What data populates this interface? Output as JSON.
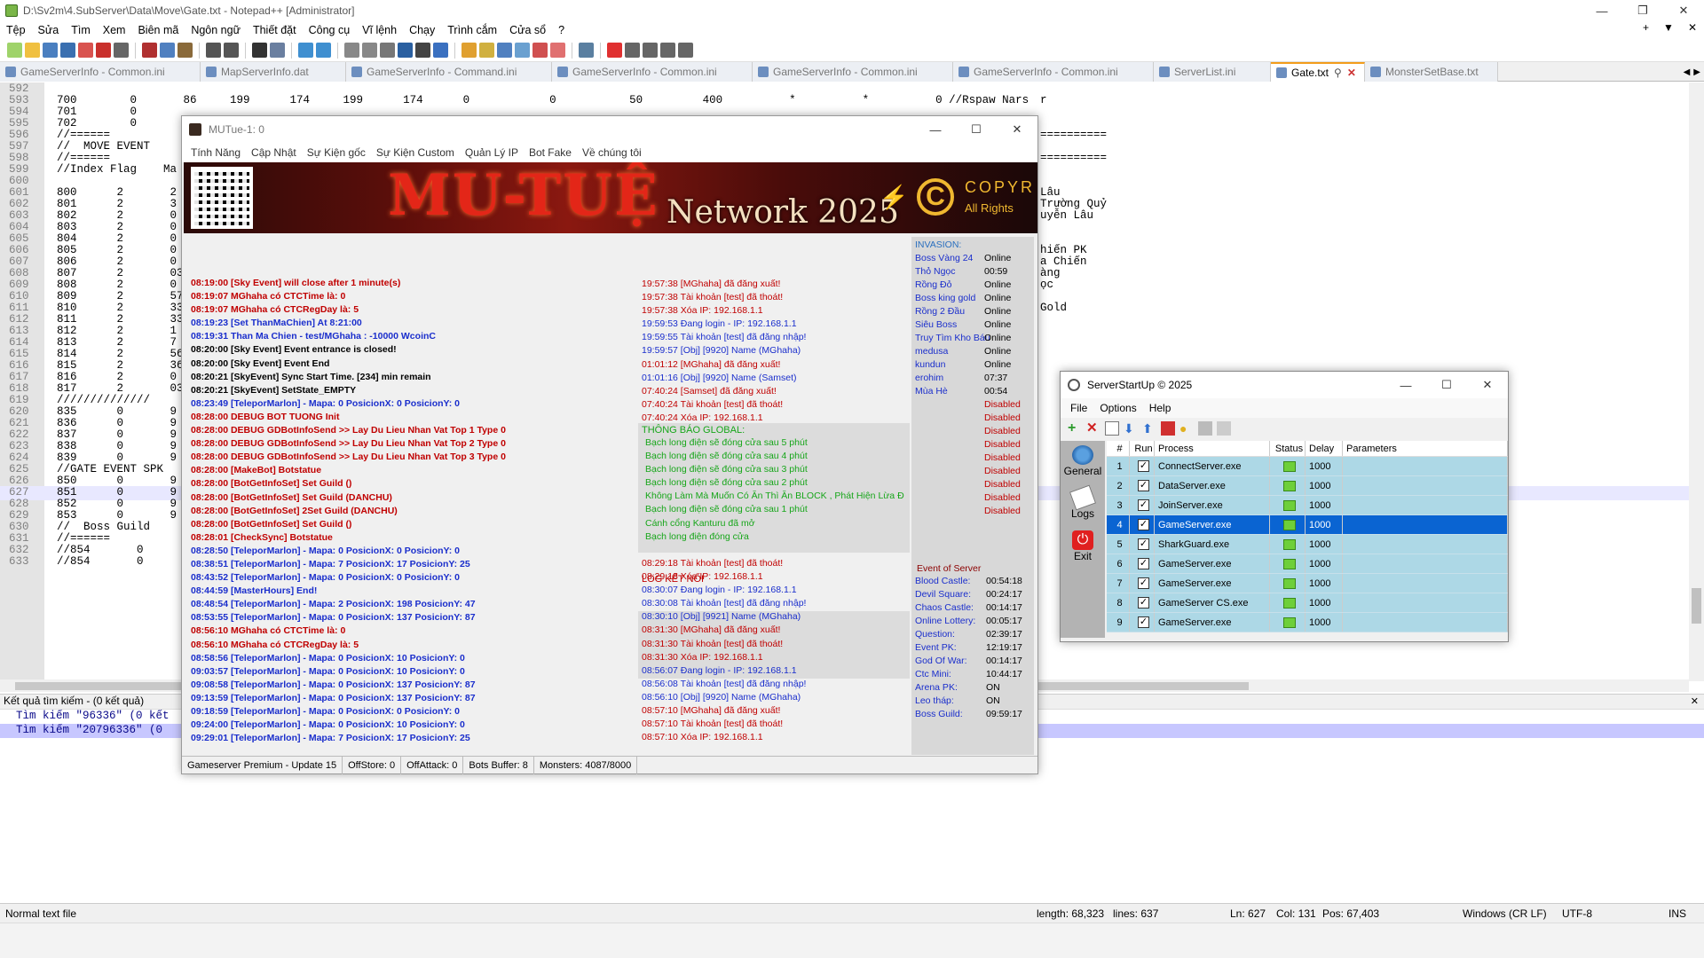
{
  "npp": {
    "title": "D:\\Sv2m\\4.SubServer\\Data\\Move\\Gate.txt - Notepad++ [Administrator]",
    "menu": [
      "Tệp",
      "Sửa",
      "Tìm",
      "Xem",
      "Biên mã",
      "Ngôn ngữ",
      "Thiết đặt",
      "Công cụ",
      "Vĩ lệnh",
      "Chạy",
      "Trình cắm",
      "Cửa sổ",
      "?"
    ],
    "menu_right": [
      "+",
      "▼",
      "✕"
    ],
    "tabs": [
      {
        "label": "GameServerInfo - Common.ini",
        "active": false
      },
      {
        "label": "MapServerInfo.dat",
        "active": false
      },
      {
        "label": "GameServerInfo - Command.ini",
        "active": false
      },
      {
        "label": "GameServerInfo - Common.ini",
        "active": false
      },
      {
        "label": "GameServerInfo - Common.ini",
        "active": false
      },
      {
        "label": "GameServerInfo - Common.ini",
        "active": false
      },
      {
        "label": "ServerList.ini",
        "active": false
      },
      {
        "label": "Gate.txt",
        "active": true
      },
      {
        "label": "MonsterSetBase.txt",
        "active": false
      }
    ],
    "lines": [
      {
        "n": "592",
        "t": ""
      },
      {
        "n": "593",
        "t": "700        0       86     199      174     199      174      0            0           50         400          *          *          0 //Rspaw Nars"
      },
      {
        "n": "594",
        "t": "701        0"
      },
      {
        "n": "595",
        "t": "702        0"
      },
      {
        "n": "596",
        "t": "//======"
      },
      {
        "n": "597",
        "t": "//  MOVE EVENT"
      },
      {
        "n": "598",
        "t": "//======"
      },
      {
        "n": "599",
        "t": "//Index Flag    Ma"
      },
      {
        "n": "600",
        "t": ""
      },
      {
        "n": "601",
        "t": "800      2       2"
      },
      {
        "n": "602",
        "t": "801      2       3"
      },
      {
        "n": "603",
        "t": "802      2       0"
      },
      {
        "n": "604",
        "t": "803      2       0"
      },
      {
        "n": "605",
        "t": "804      2       0"
      },
      {
        "n": "606",
        "t": "805      2       0"
      },
      {
        "n": "607",
        "t": "806      2       0"
      },
      {
        "n": "608",
        "t": "807      2       03"
      },
      {
        "n": "609",
        "t": "808      2       0"
      },
      {
        "n": "610",
        "t": "809      2       57"
      },
      {
        "n": "611",
        "t": "810      2       33"
      },
      {
        "n": "612",
        "t": "811      2       33"
      },
      {
        "n": "613",
        "t": "812      2       1"
      },
      {
        "n": "614",
        "t": "813      2       7"
      },
      {
        "n": "615",
        "t": "814      2       56"
      },
      {
        "n": "616",
        "t": "815      2       36"
      },
      {
        "n": "617",
        "t": "816      2       0"
      },
      {
        "n": "618",
        "t": "817      2       03"
      },
      {
        "n": "619",
        "t": "//////////////"
      },
      {
        "n": "620",
        "t": "835      0       9"
      },
      {
        "n": "621",
        "t": "836      0       9"
      },
      {
        "n": "622",
        "t": "837      0       9"
      },
      {
        "n": "623",
        "t": "838      0       9"
      },
      {
        "n": "624",
        "t": "839      0       9"
      },
      {
        "n": "625",
        "t": "//GATE EVENT SPK"
      },
      {
        "n": "626",
        "t": "850      0       9"
      },
      {
        "n": "627",
        "t": "851      0       9"
      },
      {
        "n": "628",
        "t": "852      0       9"
      },
      {
        "n": "629",
        "t": "853      0       9"
      },
      {
        "n": "630",
        "t": "//  Boss Guild"
      },
      {
        "n": "631",
        "t": "//======"
      },
      {
        "n": "632",
        "t": "//854       0"
      },
      {
        "n": "633",
        "t": "//854       0"
      }
    ],
    "right_fragments": [
      {
        "text": "r",
        "row": 1
      },
      {
        "text": "==========",
        "row": 4
      },
      {
        "text": "==========",
        "row": 6
      },
      {
        "text": "Lâu",
        "row": 9
      },
      {
        "text": "Trường Quỷ",
        "row": 10
      },
      {
        "text": "uyễn Lâu",
        "row": 11
      },
      {
        "text": "hiến PK",
        "row": 14
      },
      {
        "text": "a Chiến",
        "row": 15
      },
      {
        "text": "àng",
        "row": 16
      },
      {
        "text": "ọc",
        "row": 17
      },
      {
        "text": "Gold",
        "row": 19
      }
    ],
    "search_panel": {
      "title": "Kết quả tìm kiếm - (0 kết quả)",
      "rows": [
        "Tìm kiếm \"96336\" (0 kết",
        "Tìm kiếm \"20796336\" (0"
      ]
    },
    "status": {
      "type": "Normal text file",
      "length": "length: 68,323",
      "lines": "lines: 637",
      "ln": "Ln: 627",
      "col": "Col: 131",
      "pos": "Pos: 67,403",
      "eol": "Windows (CR LF)",
      "enc": "UTF-8",
      "ins": "INS"
    }
  },
  "mutue": {
    "title": "MUTue-1: 0",
    "menu": [
      "Tính Năng",
      "Cập Nhật",
      "Sự Kiện gốc",
      "Sự Kiện Custom",
      "Quản Lý IP",
      "Bot Fake",
      "Về chúng tôi"
    ],
    "banner": {
      "logo": "MU-TUỆ",
      "network": "Network 2025",
      "copyr": "COPYR",
      "rights": "All Rights"
    },
    "log_main": [
      {
        "c": "red",
        "t": "08:19:00 [Sky Event] will close after 1 minute(s)"
      },
      {
        "c": "red",
        "t": "08:19:07 MGhaha có CTCTime là: 0"
      },
      {
        "c": "red",
        "t": "08:19:07 MGhaha có CTCRegDay là: 5"
      },
      {
        "c": "blue",
        "t": "08:19:23 [Set ThanMaChien] At  8:21:00"
      },
      {
        "c": "blue",
        "t": "08:19:31 Than Ma Chien - test/MGhaha : -10000 WcoinC"
      },
      {
        "c": "black",
        "t": "08:20:00 [Sky Event] Event entrance is closed!"
      },
      {
        "c": "black",
        "t": "08:20:00 [Sky Event] Event End"
      },
      {
        "c": "black",
        "t": "08:20:21 [SkyEvent] Sync Start Time. [234] min remain"
      },
      {
        "c": "black",
        "t": "08:20:21 [SkyEvent] SetState_EMPTY"
      },
      {
        "c": "blue",
        "t": "08:23:49 [TeleporMarlon] - Mapa: 0 PosicionX: 0 PosicionY: 0"
      },
      {
        "c": "red",
        "t": "08:28:00 DEBUG BOT TUONG Init"
      },
      {
        "c": "red",
        "t": "08:28:00 DEBUG GDBotInfoSend >> Lay Du Lieu Nhan Vat Top 1 Type 0"
      },
      {
        "c": "red",
        "t": "08:28:00 DEBUG GDBotInfoSend >> Lay Du Lieu Nhan Vat Top 2 Type 0"
      },
      {
        "c": "red",
        "t": "08:28:00 DEBUG GDBotInfoSend >> Lay Du Lieu Nhan Vat Top 3 Type 0"
      },
      {
        "c": "red",
        "t": "08:28:00 [MakeBot] Botstatue"
      },
      {
        "c": "red",
        "t": "08:28:00 [BotGetInfoSet] Set Guild ()"
      },
      {
        "c": "red",
        "t": "08:28:00 [BotGetInfoSet] Set Guild (DANCHU)"
      },
      {
        "c": "red",
        "t": "08:28:00 [BotGetInfoSet] 2Set Guild (DANCHU)"
      },
      {
        "c": "red",
        "t": "08:28:00 [BotGetInfoSet] Set Guild ()"
      },
      {
        "c": "red",
        "t": "08:28:01 [CheckSync] Botstatue"
      },
      {
        "c": "blue",
        "t": "08:28:50 [TeleporMarlon] - Mapa: 0 PosicionX: 0 PosicionY: 0"
      },
      {
        "c": "blue",
        "t": "08:38:51 [TeleporMarlon] - Mapa: 7 PosicionX: 17 PosicionY: 25"
      },
      {
        "c": "blue",
        "t": "08:43:52 [TeleporMarlon] - Mapa: 0 PosicionX: 0 PosicionY: 0"
      },
      {
        "c": "blue",
        "t": "08:44:59 [MasterHours] End!"
      },
      {
        "c": "blue",
        "t": "08:48:54 [TeleporMarlon] - Mapa: 2 PosicionX: 198 PosicionY: 47"
      },
      {
        "c": "blue",
        "t": "08:53:55 [TeleporMarlon] - Mapa: 0 PosicionX: 137 PosicionY: 87"
      },
      {
        "c": "red",
        "t": "08:56:10 MGhaha có CTCTime là: 0"
      },
      {
        "c": "red",
        "t": "08:56:10 MGhaha có CTCRegDay là: 5"
      },
      {
        "c": "blue",
        "t": "08:58:56 [TeleporMarlon] - Mapa: 0 PosicionX: 10 PosicionY: 0"
      },
      {
        "c": "blue",
        "t": "09:03:57 [TeleporMarlon] - Mapa: 0 PosicionX: 10 PosicionY: 0"
      },
      {
        "c": "blue",
        "t": "09:08:58 [TeleporMarlon] - Mapa: 0 PosicionX: 137 PosicionY: 87"
      },
      {
        "c": "blue",
        "t": "09:13:59 [TeleporMarlon] - Mapa: 0 PosicionX: 137 PosicionY: 87"
      },
      {
        "c": "blue",
        "t": "09:18:59 [TeleporMarlon] - Mapa: 0 PosicionX: 0 PosicionY: 0"
      },
      {
        "c": "blue",
        "t": "09:24:00 [TeleporMarlon] - Mapa: 0 PosicionX: 10 PosicionY: 0"
      },
      {
        "c": "blue",
        "t": "09:29:01 [TeleporMarlon] - Mapa: 7 PosicionX: 17 PosicionY: 25"
      }
    ],
    "log_conn_top": [
      {
        "c": "red",
        "t": "19:57:38 [MGhaha] đã đăng xuất!"
      },
      {
        "c": "red",
        "t": "19:57:38 Tài khoản [test] đã thoát!"
      },
      {
        "c": "red",
        "t": "19:57:38 Xóa IP: 192.168.1.1"
      },
      {
        "c": "blue",
        "t": "19:59:53 Đang login - IP: 192.168.1.1"
      },
      {
        "c": "blue",
        "t": "19:59:55 Tài khoản [test] đã đăng nhập!"
      },
      {
        "c": "blue",
        "t": "19:59:57 [Obj] [9920] Name (MGhaha)"
      },
      {
        "c": "red",
        "t": "01:01:12 [MGhaha] đã đăng xuất!"
      },
      {
        "c": "blue",
        "t": "01:01:16 [Obj] [9920] Name (Samset)"
      },
      {
        "c": "red",
        "t": "07:40:24 [Samset] đã đăng xuất!"
      },
      {
        "c": "red",
        "t": "07:40:24 Tài khoản [test] đã thoát!"
      },
      {
        "c": "red",
        "t": "07:40:24 Xóa IP: 192.168.1.1"
      }
    ],
    "global_title": "THÔNG BÁO GLOBAL:",
    "global": [
      "Bạch long điện sẽ đóng cửa sau 5 phút",
      "Bạch long điện sẽ đóng cửa sau 4 phút",
      "Bạch long điện sẽ đóng cửa sau 3 phút",
      "Bạch long điện sẽ đóng cửa sau 2 phút",
      "Không Làm Mà Muốn Có Ăn Thì Ăn BLOCK , Phát Hiện Lừa Đ",
      "Bạch long điện sẽ đóng cửa sau 1 phút",
      "Cánh cổng Kanturu đã mở",
      "Bạch long điện đóng cửa"
    ],
    "log_ketnoi_label": "LOG KẾT NỐI",
    "log_conn_bottom": [
      {
        "c": "red",
        "t": "08:29:18 Tài khoản [test] đã thoát!",
        "shade": false
      },
      {
        "c": "red",
        "t": "08:29:18 Xóa IP: 192.168.1.1",
        "shade": false
      },
      {
        "c": "blue",
        "t": "08:30:07 Đang login - IP: 192.168.1.1",
        "shade": false
      },
      {
        "c": "blue",
        "t": "08:30:08 Tài khoản [test] đã đăng nhập!",
        "shade": false
      },
      {
        "c": "blue",
        "t": "08:30:10 [Obj] [9921] Name (MGhaha)",
        "shade": true
      },
      {
        "c": "red",
        "t": "08:31:30 [MGhaha] đã đăng xuất!",
        "shade": true
      },
      {
        "c": "red",
        "t": "08:31:30 Tài khoản [test] đã thoát!",
        "shade": true
      },
      {
        "c": "red",
        "t": "08:31:30 Xóa IP: 192.168.1.1",
        "shade": true
      },
      {
        "c": "blue",
        "t": "08:56:07 Đang login - IP: 192.168.1.1",
        "shade": true
      },
      {
        "c": "blue",
        "t": "08:56:08 Tài khoản [test] đã đăng nhập!",
        "shade": false
      },
      {
        "c": "blue",
        "t": "08:56:10 [Obj] [9920] Name (MGhaha)",
        "shade": false
      },
      {
        "c": "red",
        "t": "08:57:10 [MGhaha] đã đăng xuất!",
        "shade": false
      },
      {
        "c": "red",
        "t": "08:57:10 Tài khoản [test] đã thoát!",
        "shade": false
      },
      {
        "c": "red",
        "t": "08:57:10 Xóa IP: 192.168.1.1",
        "shade": false
      }
    ],
    "invasion_title": "INVASION:",
    "invasion": [
      {
        "n": "Boss Vàng 24",
        "v": "Online",
        "dis": false
      },
      {
        "n": "Thỏ Ngọc",
        "v": "00:59",
        "dis": false
      },
      {
        "n": "Rồng Đỏ",
        "v": "Online",
        "dis": false
      },
      {
        "n": "Boss king gold",
        "v": "Online",
        "dis": false
      },
      {
        "n": "Rồng 2 Đầu",
        "v": "Online",
        "dis": false
      },
      {
        "n": "Siêu Boss",
        "v": "Online",
        "dis": false
      },
      {
        "n": "Truy Tìm Kho Báu",
        "v": "Online",
        "dis": false
      },
      {
        "n": "medusa",
        "v": "Online",
        "dis": false
      },
      {
        "n": "kundun",
        "v": "Online",
        "dis": false
      },
      {
        "n": "erohim",
        "v": "07:37",
        "dis": false
      },
      {
        "n": "Mùa Hè",
        "v": "00:54",
        "dis": false
      },
      {
        "n": "",
        "v": "Disabled",
        "dis": true
      },
      {
        "n": "",
        "v": "Disabled",
        "dis": true
      },
      {
        "n": "",
        "v": "Disabled",
        "dis": true
      },
      {
        "n": "",
        "v": "Disabled",
        "dis": true
      },
      {
        "n": "",
        "v": "Disabled",
        "dis": true
      },
      {
        "n": "",
        "v": "Disabled",
        "dis": true
      },
      {
        "n": "",
        "v": "Disabled",
        "dis": true
      },
      {
        "n": "",
        "v": "Disabled",
        "dis": true
      },
      {
        "n": "",
        "v": "Disabled",
        "dis": true
      }
    ],
    "event_title": "Event of Server",
    "events": [
      {
        "n": "Blood Castle:",
        "v": "00:54:18"
      },
      {
        "n": "Devil Square:",
        "v": "00:24:17"
      },
      {
        "n": "Chaos Castle:",
        "v": "00:14:17"
      },
      {
        "n": "Online Lottery:",
        "v": "00:05:17"
      },
      {
        "n": "Question:",
        "v": "02:39:17"
      },
      {
        "n": "Event PK:",
        "v": "12:19:17"
      },
      {
        "n": "God Of War:",
        "v": "00:14:17"
      },
      {
        "n": "Ctc Mini:",
        "v": "10:44:17"
      },
      {
        "n": "Arena PK:",
        "v": "ON"
      },
      {
        "n": "Leo tháp:",
        "v": "ON"
      },
      {
        "n": "Boss Guild:",
        "v": "09:59:17"
      }
    ],
    "status": [
      "Gameserver Premium - Update 15",
      "OffStore: 0",
      "OffAttack: 0",
      "Bots Buffer: 8",
      "Monsters: 4087/8000"
    ]
  },
  "ssu": {
    "title": "ServerStartUp © 2025",
    "menu": [
      "File",
      "Options",
      "Help"
    ],
    "side": [
      "General",
      "Logs",
      "Exit"
    ],
    "headers": [
      "#",
      "Run",
      "Process",
      "Status",
      "Delay",
      "Parameters"
    ],
    "rows": [
      {
        "num": "1",
        "proc": "ConnectServer.exe",
        "delay": "1000",
        "sel": false
      },
      {
        "num": "2",
        "proc": "DataServer.exe",
        "delay": "1000",
        "sel": false
      },
      {
        "num": "3",
        "proc": "JoinServer.exe",
        "delay": "1000",
        "sel": false
      },
      {
        "num": "4",
        "proc": "GameServer.exe",
        "delay": "1000",
        "sel": true
      },
      {
        "num": "5",
        "proc": "SharkGuard.exe",
        "delay": "1000",
        "sel": false
      },
      {
        "num": "6",
        "proc": "GameServer.exe",
        "delay": "1000",
        "sel": false
      },
      {
        "num": "7",
        "proc": "GameServer.exe",
        "delay": "1000",
        "sel": false
      },
      {
        "num": "8",
        "proc": "GameServer CS.exe",
        "delay": "1000",
        "sel": false
      },
      {
        "num": "9",
        "proc": "GameServer.exe",
        "delay": "1000",
        "sel": false
      }
    ]
  },
  "colors": {
    "log_red": "#c00000",
    "log_blue": "#1a2ecc",
    "log_green": "#17a61a",
    "selected_row": "#0a64d2",
    "process_row": "#add8e6",
    "status_ok": "#6ecf3a"
  }
}
